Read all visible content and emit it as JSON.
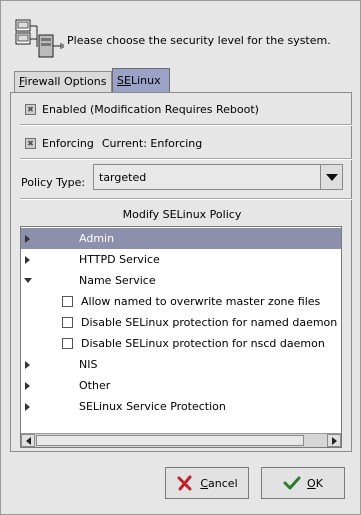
{
  "header": {
    "text": "Please choose the security level for the system.",
    "icon": "computers-network-icon"
  },
  "tabs": [
    {
      "label_prefix": "",
      "label_ul": "F",
      "label_rest": "irewall Options",
      "active": false
    },
    {
      "label_prefix": "",
      "label_ul": "SE",
      "label_rest": "Linux",
      "active": true
    }
  ],
  "selinux": {
    "enabled_label": "Enabled (Modification Requires Reboot)",
    "enabled_checked": true,
    "enforcing_label": "Enforcing",
    "enforcing_checked": true,
    "current_label": "Current: Enforcing",
    "policy_type_label": "Policy Type:",
    "policy_type_value": "targeted",
    "modify_title": "Modify SELinux Policy"
  },
  "tree": [
    {
      "kind": "group",
      "label": "Admin",
      "expanded": false,
      "selected": true
    },
    {
      "kind": "group",
      "label": "HTTPD Service",
      "expanded": false,
      "selected": false
    },
    {
      "kind": "group",
      "label": "Name Service",
      "expanded": true,
      "selected": false
    },
    {
      "kind": "option",
      "label": "Allow named to overwrite master zone files",
      "checked": false
    },
    {
      "kind": "option",
      "label": "Disable SELinux protection for named daemon",
      "checked": false
    },
    {
      "kind": "option",
      "label": "Disable SELinux protection for nscd daemon",
      "checked": false
    },
    {
      "kind": "group",
      "label": "NIS",
      "expanded": false,
      "selected": false
    },
    {
      "kind": "group",
      "label": "Other",
      "expanded": false,
      "selected": false
    },
    {
      "kind": "group",
      "label": "SELinux Service Protection",
      "expanded": false,
      "selected": false
    }
  ],
  "buttons": {
    "cancel_ul": "C",
    "cancel_rest": "ancel",
    "ok_ul": "O",
    "ok_rest": "K"
  },
  "colors": {
    "selection": "#8c90ad",
    "active_tab": "#9aa3c7"
  }
}
